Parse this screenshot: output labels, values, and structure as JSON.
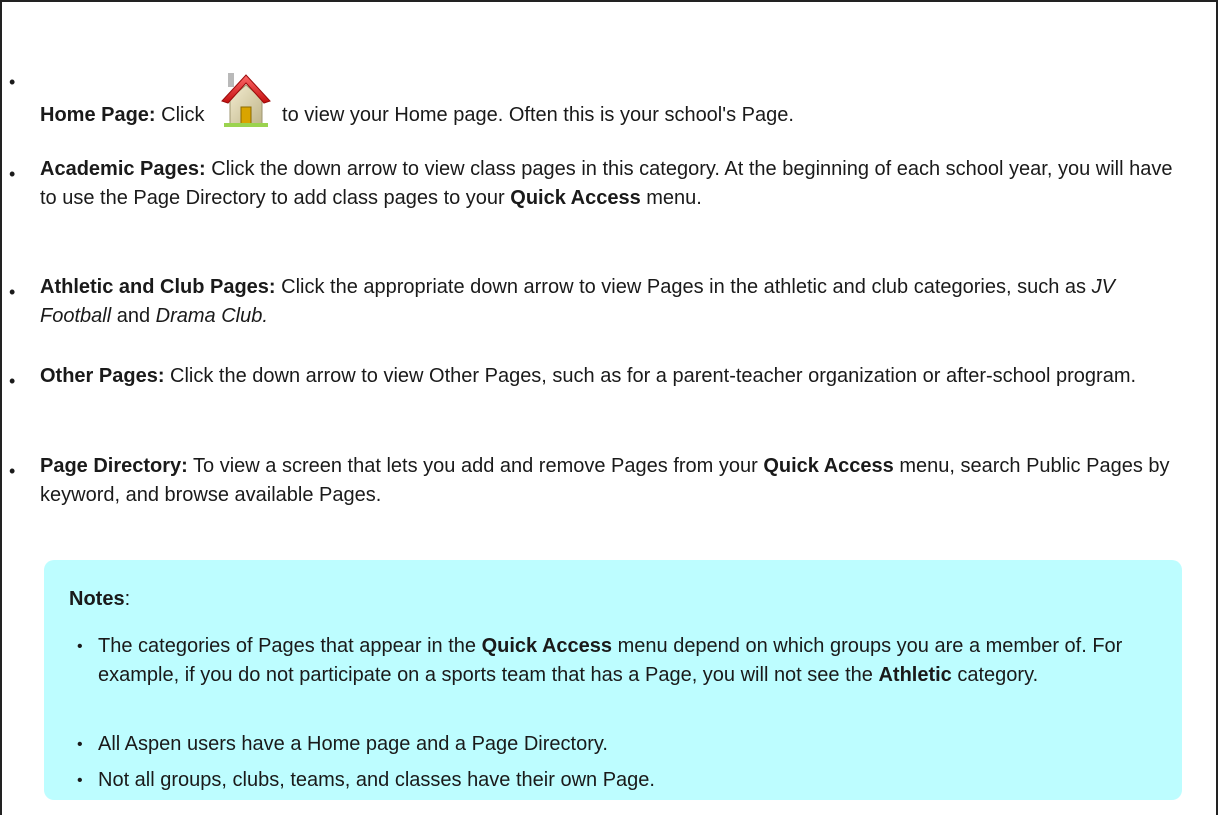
{
  "items": [
    {
      "label": "Home Page:",
      "text_before_icon": " Click ",
      "icon": "home-icon",
      "text_after_icon": "to view your Home page. Often this is your school's Page."
    },
    {
      "label": "Academic Pages:",
      "text1": " Click the down arrow to view class pages in this category. At the beginning of each school year, you will have to use the Page Directory to add class pages to your ",
      "bold1": "Quick Access",
      "text2": " menu."
    },
    {
      "label": "Athletic and Club Pages:",
      "text1": " Click the appropriate down arrow to view Pages in the athletic and club categories, such as ",
      "italic1": "JV Football",
      "text2": " and ",
      "italic2": "Drama Club."
    },
    {
      "label": "Other Pages:",
      "text1": " Click the down arrow to view Other Pages, such as for a parent-teacher organization or after-school program."
    },
    {
      "label": "Page Directory:",
      "text1": " To view a screen that lets you add and remove Pages from your ",
      "bold1": "Quick Access",
      "text2": " menu, search Public Pages by keyword, and browse available Pages."
    }
  ],
  "notes": {
    "title": "Notes",
    "title_suffix": ":",
    "items": [
      {
        "text1": "The categories of Pages that appear in the ",
        "bold1": "Quick Access",
        "text2": " menu depend on which groups you are a member of. For example, if you do not participate on a sports team that has a Page, you will not see the ",
        "bold2": "Athletic",
        "text3": " category."
      },
      {
        "text1": "All Aspen users have a Home page and a Page Directory."
      },
      {
        "text1": "Not all groups, clubs, teams, and classes have their own Page."
      }
    ]
  },
  "colors": {
    "notes_background": "#bdfdff",
    "border": "#222222",
    "icon_roof": "#d81f1f",
    "icon_wall": "#d9d2a8"
  },
  "bullet_glyph": "•"
}
